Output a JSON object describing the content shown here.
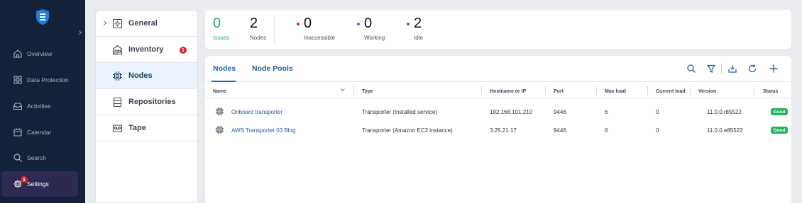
{
  "sidebar": {
    "items": [
      {
        "label": "Overview",
        "icon": "home-icon"
      },
      {
        "label": "Data Protection",
        "icon": "grid-icon"
      },
      {
        "label": "Activities",
        "icon": "inbox-icon"
      },
      {
        "label": "Calendar",
        "icon": "calendar-icon"
      },
      {
        "label": "Search",
        "icon": "search-icon"
      },
      {
        "label": "Settings",
        "icon": "gear-icon",
        "badge": "1",
        "active": true
      }
    ]
  },
  "submenu": {
    "items": [
      {
        "label": "General",
        "icon": "settings-box-icon"
      },
      {
        "label": "Inventory",
        "icon": "inventory-icon",
        "badge": "1"
      },
      {
        "label": "Nodes",
        "icon": "chip-icon",
        "active": true
      },
      {
        "label": "Repositories",
        "icon": "repository-icon"
      },
      {
        "label": "Tape",
        "icon": "tape-icon"
      }
    ]
  },
  "stats": {
    "issues": {
      "value": "0",
      "label": "Issues",
      "color": "#25b05b"
    },
    "nodes": {
      "value": "2",
      "label": "Nodes"
    },
    "inaccessible": {
      "value": "0",
      "label": "Inaccessible",
      "color": "#e0202b"
    },
    "working": {
      "value": "0",
      "label": "Working",
      "color": "#2f80ed"
    },
    "idle": {
      "value": "2",
      "label": "Idle",
      "color": "#5b6675"
    }
  },
  "tabs": [
    {
      "label": "Nodes",
      "active": true
    },
    {
      "label": "Node Pools"
    }
  ],
  "toolbar": [
    "search-icon",
    "filter-icon",
    "download-icon",
    "refresh-icon",
    "add-icon"
  ],
  "table": {
    "columns": [
      "Name",
      "Type",
      "Hostname or IP",
      "Port",
      "Max load",
      "Current load",
      "Version",
      "Status"
    ],
    "rows": [
      {
        "name": "Onboard transporter",
        "type": "Transporter (Installed service)",
        "host": "192.168.101.210",
        "port": "9446",
        "max_load": "6",
        "current_load": "0",
        "version": "11.0.0.r85522",
        "status": "Good"
      },
      {
        "name": "AWS Transporter 03 Blog",
        "type": "Transporter (Amazon EC2 instance)",
        "host": "3.25.21.17",
        "port": "9446",
        "max_load": "6",
        "current_load": "0",
        "version": "11.0.0.e85522",
        "status": "Good"
      }
    ]
  },
  "colors": {
    "sidebar": "#132238",
    "accent": "#1d66b8",
    "good": "#23b35c",
    "badge": "#e0202b"
  }
}
